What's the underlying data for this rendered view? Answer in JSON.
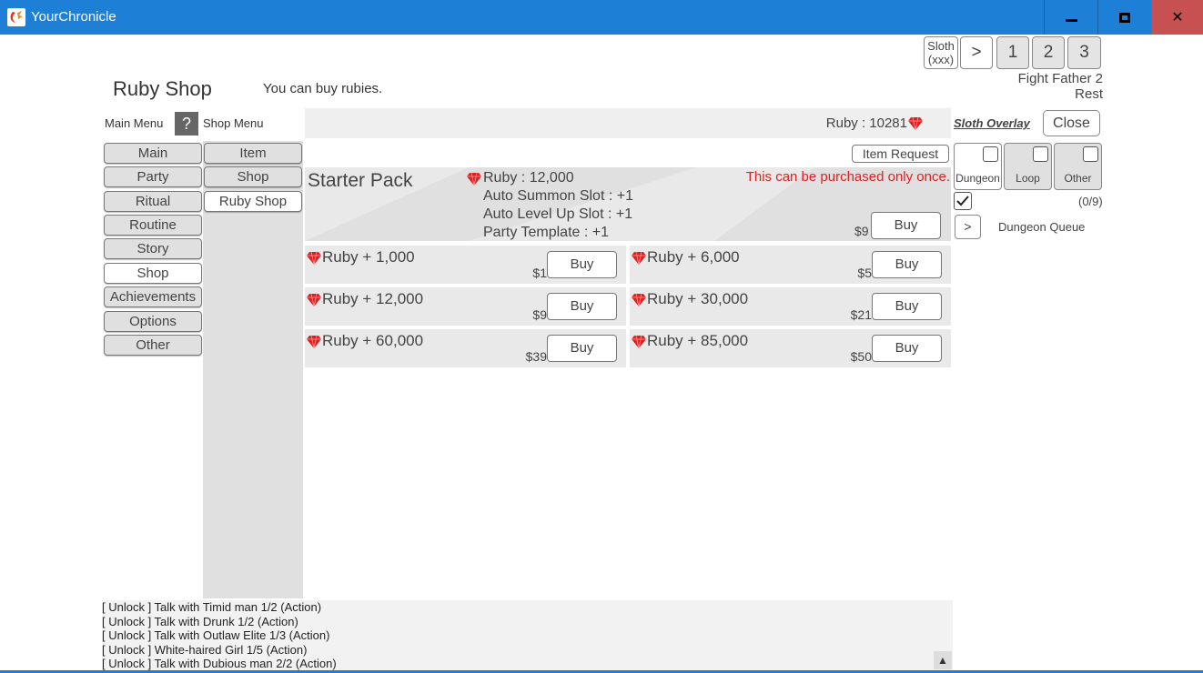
{
  "window": {
    "title": "YourChronicle"
  },
  "top_controls": {
    "sloth_line1": "Sloth",
    "sloth_line2": "(xxx)",
    "next": ">",
    "pages": [
      "1",
      "2",
      "3"
    ],
    "fight_line1": "Fight Father 2",
    "fight_line2": "Rest"
  },
  "header": {
    "title": "Ruby Shop",
    "description": "You can buy rubies."
  },
  "menus": {
    "main_label": "Main Menu",
    "help": "?",
    "shop_label": "Shop Menu",
    "main_items": [
      "Main",
      "Party",
      "Ritual",
      "Routine",
      "Story",
      "Shop",
      "Achievements",
      "Options",
      "Other"
    ],
    "main_active": "Shop",
    "shop_items": [
      "Item",
      "Shop",
      "Ruby Shop"
    ],
    "shop_active": "Ruby Shop"
  },
  "ruby_bar": {
    "balance": "Ruby : 10281",
    "overlay": "Sloth Overlay",
    "close": "Close",
    "item_request": "Item Request"
  },
  "starter_pack": {
    "title": "Starter Pack",
    "lines": [
      "Ruby : 12,000",
      "Auto Summon Slot : +1",
      "Auto Level Up Slot : +1",
      "Party Template : +1"
    ],
    "note": "This can be purchased only once.",
    "price": "$9",
    "buy": "Buy"
  },
  "packages": [
    {
      "label": "Ruby + 1,000",
      "price": "$1",
      "buy": "Buy"
    },
    {
      "label": "Ruby + 6,000",
      "price": "$5",
      "buy": "Buy"
    },
    {
      "label": "Ruby + 12,000",
      "price": "$9",
      "buy": "Buy"
    },
    {
      "label": "Ruby + 30,000",
      "price": "$21",
      "buy": "Buy"
    },
    {
      "label": "Ruby + 60,000",
      "price": "$39",
      "buy": "Buy"
    },
    {
      "label": "Ruby + 85,000",
      "price": "$50",
      "buy": "Buy"
    }
  ],
  "filters": {
    "items": [
      {
        "label": "Dungeon",
        "checked": false
      },
      {
        "label": "Loop",
        "checked": false
      },
      {
        "label": "Other",
        "checked": false
      }
    ],
    "count": "(0/9)",
    "queue_arrow": ">",
    "queue_label": "Dungeon Queue"
  },
  "log": [
    "[ Unlock ] Talk with Timid man 1/2 (Action)",
    "[ Unlock ] Talk with Drunk 1/2 (Action)",
    "[ Unlock ] Talk with Outlaw Elite 1/3 (Action)",
    "[ Unlock ] White-haired Girl 1/5 (Action)",
    "[ Unlock ] Talk with Dubious man 2/2 (Action)"
  ],
  "colors": {
    "titlebar": "#1e7fd6",
    "close_red": "#c75050",
    "ruby_red": "#e02020",
    "warning_text": "#e02020"
  }
}
